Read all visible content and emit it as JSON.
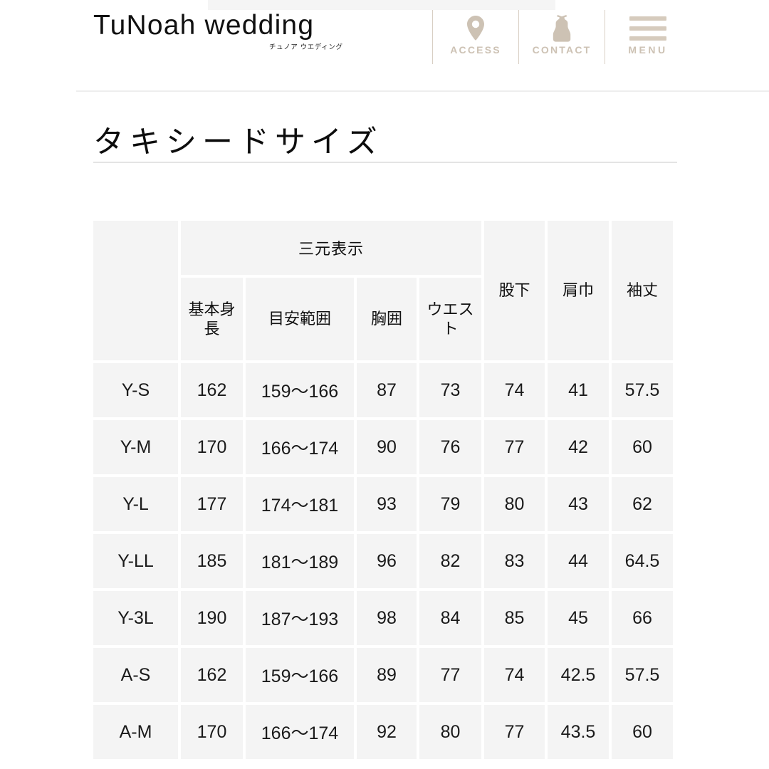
{
  "header": {
    "logo_text": "TuNoah wedding",
    "logo_subtitle": "チュノア ウエディング",
    "nav": [
      {
        "label": "ACCESS",
        "icon": "map-pin-icon"
      },
      {
        "label": "CONTACT",
        "icon": "dress-icon"
      },
      {
        "label": "MENU",
        "icon": "hamburger-icon"
      }
    ]
  },
  "page": {
    "title": "タキシードサイズ"
  },
  "table": {
    "group_header": "三元表示",
    "corner_header": "",
    "sub_headers": [
      "基本\n身長",
      "目安範囲",
      "胸囲",
      "ウエ\nスト"
    ],
    "sub_header_1": "基本身長",
    "sub_header_2": "目安範囲",
    "sub_header_3": "胸囲",
    "sub_header_4": "ウエスト",
    "right_headers": [
      "股下",
      "肩巾",
      "袖丈"
    ],
    "right_header_1": "股下",
    "right_header_2": "肩巾",
    "right_header_3": "袖丈",
    "rows": [
      {
        "size": "Y-S",
        "height": "162",
        "range": "159〜166",
        "chest": "87",
        "waist": "73",
        "inseam": "74",
        "shoulder": "41",
        "sleeve": "57.5"
      },
      {
        "size": "Y-M",
        "height": "170",
        "range": "166〜174",
        "chest": "90",
        "waist": "76",
        "inseam": "77",
        "shoulder": "42",
        "sleeve": "60"
      },
      {
        "size": "Y-L",
        "height": "177",
        "range": "174〜181",
        "chest": "93",
        "waist": "79",
        "inseam": "80",
        "shoulder": "43",
        "sleeve": "62"
      },
      {
        "size": "Y-LL",
        "height": "185",
        "range": "181〜189",
        "chest": "96",
        "waist": "82",
        "inseam": "83",
        "shoulder": "44",
        "sleeve": "64.5"
      },
      {
        "size": "Y-3L",
        "height": "190",
        "range": "187〜193",
        "chest": "98",
        "waist": "84",
        "inseam": "85",
        "shoulder": "45",
        "sleeve": "66"
      },
      {
        "size": "A-S",
        "height": "162",
        "range": "159〜166",
        "chest": "89",
        "waist": "77",
        "inseam": "74",
        "shoulder": "42.5",
        "sleeve": "57.5"
      },
      {
        "size": "A-M",
        "height": "170",
        "range": "166〜174",
        "chest": "92",
        "waist": "80",
        "inseam": "77",
        "shoulder": "43.5",
        "sleeve": "60"
      }
    ]
  },
  "colors": {
    "accent_beige": "#cdc2b4",
    "cell_bg": "#f4f4f4",
    "page_bg": "#ffffff",
    "text": "#1a1a1a",
    "rule": "#e4e4e4"
  }
}
